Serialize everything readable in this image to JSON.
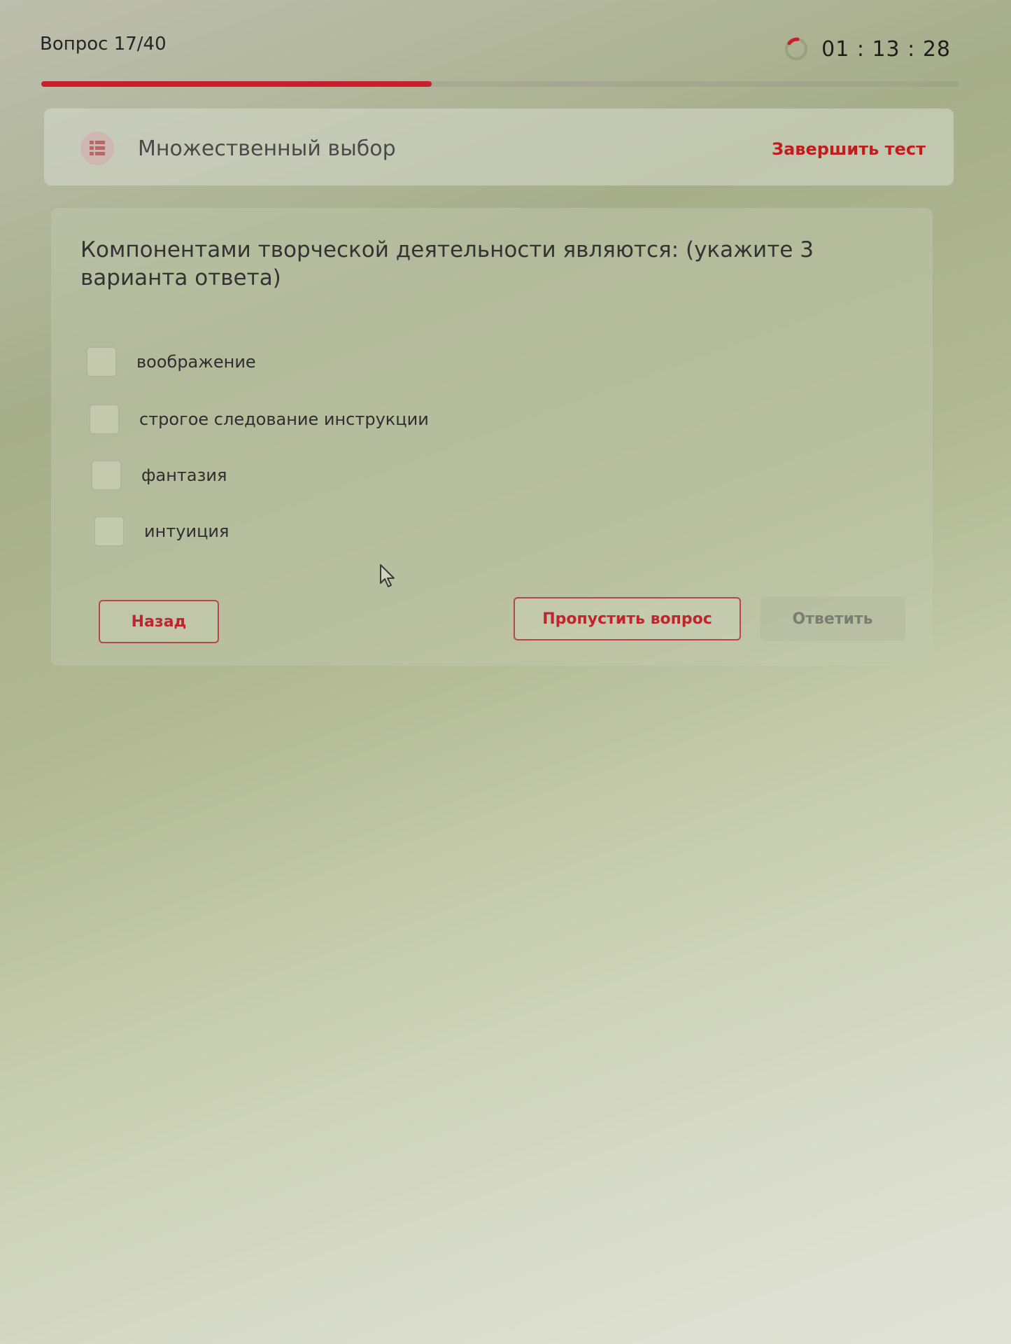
{
  "header": {
    "question_counter": "Вопрос 17/40",
    "timer": "01 : 13 : 28",
    "progress_fraction": 0.425
  },
  "question_type": {
    "label": "Множественный выбор",
    "finish_label": "Завершить тест",
    "icon": "list-icon"
  },
  "question": {
    "text": "Компонентами творческой деятельности являются: (укажите 3 варианта ответа)",
    "options": [
      {
        "label": "воображение",
        "checked": false
      },
      {
        "label": "строгое следование инструкции",
        "checked": false
      },
      {
        "label": "фантазия",
        "checked": false
      },
      {
        "label": "интуиция",
        "checked": false
      }
    ]
  },
  "buttons": {
    "back": "Назад",
    "skip": "Пропустить вопрос",
    "answer": "Ответить"
  },
  "colors": {
    "accent": "#c6202c",
    "disabled": "#7a7d70"
  }
}
